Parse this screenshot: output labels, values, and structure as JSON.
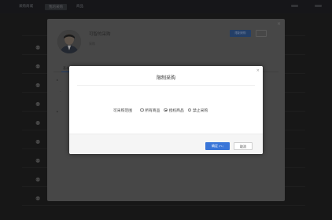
{
  "topbar": {
    "nav": [
      "采购商城",
      "我的采购",
      "商品"
    ],
    "active_index": 1
  },
  "profile": {
    "name": "可智的采购",
    "subtitle": "采购",
    "primary_button": "限制采购",
    "tab": "基本信息"
  },
  "modal": {
    "title": "限制采购",
    "range_label": "可采购范围",
    "options": [
      {
        "label": "所有商品",
        "checked": false
      },
      {
        "label": "授权商品",
        "checked": true
      },
      {
        "label": "禁止采购",
        "checked": false
      }
    ],
    "ok_label": "确定",
    "ok_shortcut": "(F1)",
    "cancel_label": "取消",
    "close_symbol": "×"
  }
}
